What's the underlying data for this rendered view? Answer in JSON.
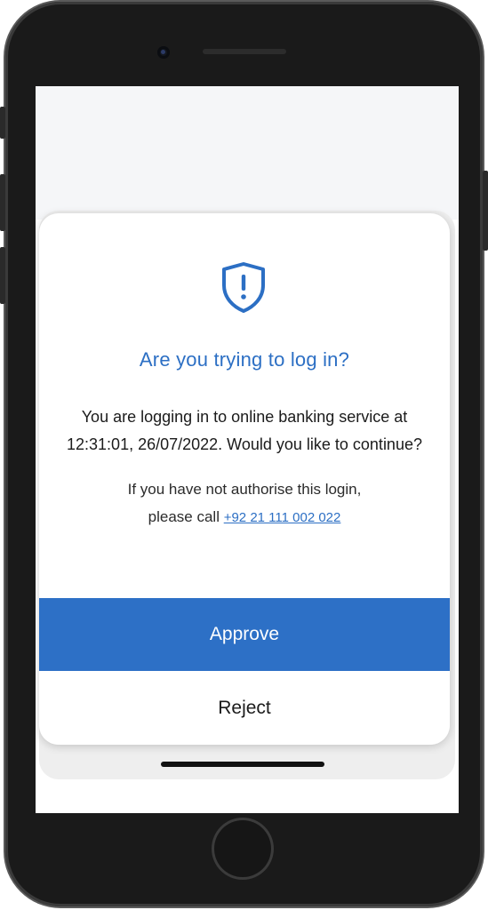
{
  "dialog": {
    "title": "Are you trying to log in?",
    "message": "You are logging in to online banking service at 12:31:01, 26/07/2022. Would you like to continue?",
    "help_line1": "If you have not authorise this login,",
    "help_line2_prefix": "please call ",
    "phone_number": "+92 21 111 002 022",
    "approve_label": "Approve",
    "reject_label": "Reject"
  },
  "colors": {
    "accent": "#2d70c6",
    "title": "#2c6fc4",
    "text": "#1b1b1b"
  },
  "icons": {
    "alert": "shield-exclamation-icon"
  }
}
